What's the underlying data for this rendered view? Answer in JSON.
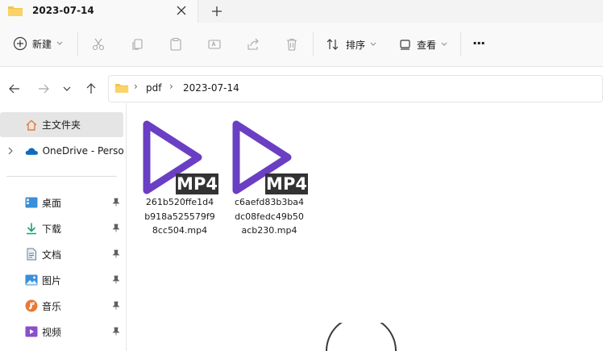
{
  "tab": {
    "title": "2023-07-14"
  },
  "toolbar": {
    "new_label": "新建",
    "sort_label": "排序",
    "view_label": "查看",
    "more_label": "···"
  },
  "address": {
    "crumbs": [
      "pdf",
      "2023-07-14"
    ]
  },
  "sidebar": {
    "home": "主文件夹",
    "onedrive": "OneDrive - Perso",
    "quick": [
      {
        "label": "桌面",
        "icon": "desktop-icon"
      },
      {
        "label": "下载",
        "icon": "download-icon"
      },
      {
        "label": "文档",
        "icon": "documents-icon"
      },
      {
        "label": "图片",
        "icon": "pictures-icon"
      },
      {
        "label": "音乐",
        "icon": "music-icon"
      },
      {
        "label": "视频",
        "icon": "videos-icon"
      }
    ]
  },
  "files": [
    {
      "badge": "MP4",
      "name": "261b520ffe1d4b918a525579f98cc504.mp4",
      "lines": [
        "261b520ffe1d4",
        "b918a525579f9",
        "8cc504.mp4"
      ]
    },
    {
      "badge": "MP4",
      "name": "c6aefd83b3ba4dc08fedc49b50acb230.mp4",
      "lines": [
        "c6aefd83b3ba4",
        "dc08fedc49b50",
        "acb230.mp4"
      ]
    }
  ],
  "colors": {
    "accent": "#6a3fc3",
    "folder": "#f6c343",
    "onedrive": "#0f6cbd"
  }
}
